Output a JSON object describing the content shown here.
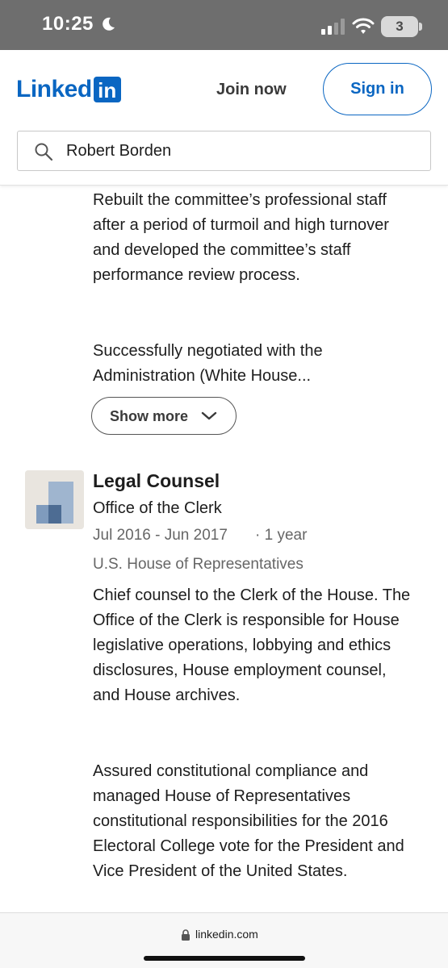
{
  "status_bar": {
    "time": "10:25",
    "battery": "3"
  },
  "header": {
    "logo_text": "Linked",
    "logo_in": "in",
    "join_label": "Join now",
    "signin_label": "Sign in"
  },
  "search": {
    "value": "Robert Borden"
  },
  "experience": {
    "prev_para1": "Rebuilt the committee’s professional staff after a period of turmoil and high turnover and developed the committee’s staff performance review process.",
    "prev_para2": "Successfully negotiated with the Administration (White House...",
    "show_more_label": "Show more",
    "job": {
      "title": "Legal Counsel",
      "company": "Office of the Clerk",
      "dates": "Jul 2016 - Jun 2017",
      "duration": "· 1 year",
      "location": "U.S. House of Representatives",
      "desc1": "Chief counsel to the Clerk of the House. The Office of the Clerk is responsible for House legislative operations, lobbying and ethics disclosures, House employment counsel, and House archives.",
      "desc2": "Assured constitutional compliance and managed House of Representatives constitutional responsibilities for the 2016 Electoral College vote for the President and Vice President of the United States."
    }
  },
  "browser": {
    "url": "linkedin.com"
  },
  "colors": {
    "brand": "#0a66c2",
    "status_bar_bg": "#6e6e6e",
    "muted_text": "#666666"
  }
}
